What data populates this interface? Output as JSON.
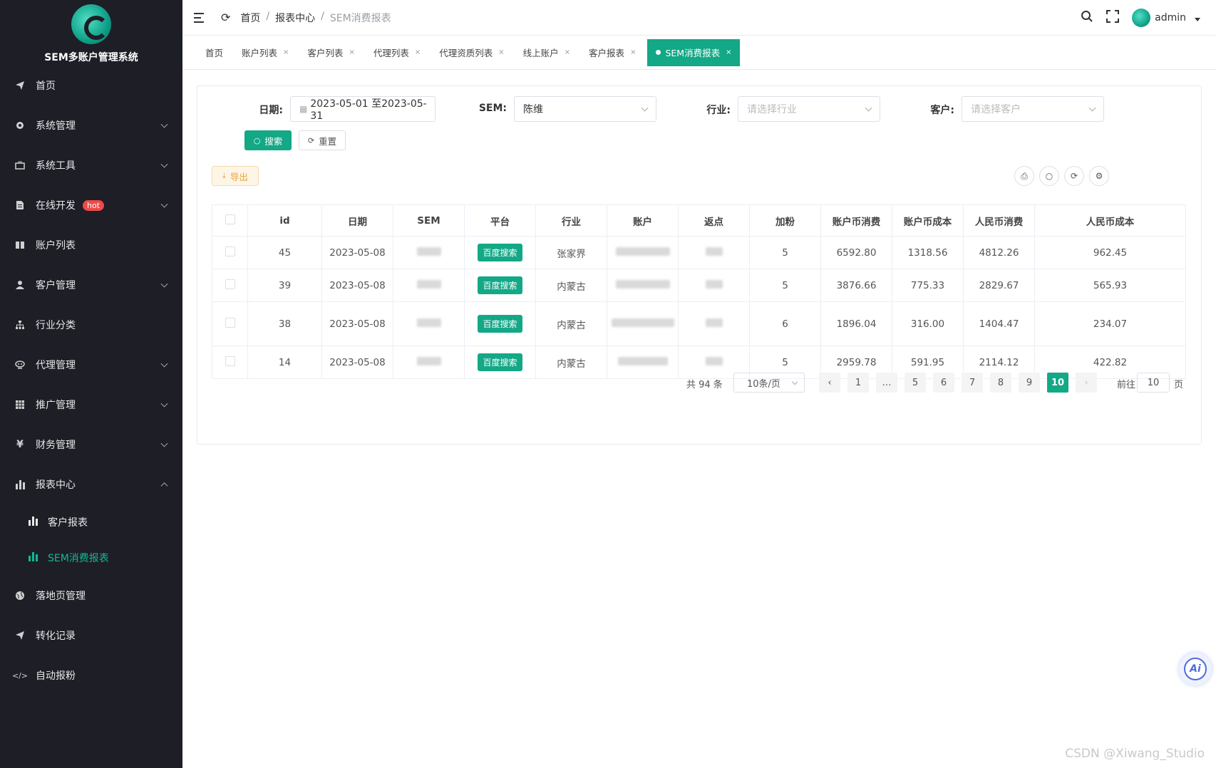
{
  "sidebar": {
    "title": "SEM多账户管理系统",
    "items": [
      {
        "label": "首页",
        "icon": "paper-plane-icon"
      },
      {
        "label": "系统管理",
        "icon": "gear-icon"
      },
      {
        "label": "系统工具",
        "icon": "toolbox-icon"
      },
      {
        "label": "在线开发",
        "icon": "document-icon",
        "badge": "hot"
      },
      {
        "label": "账户列表",
        "icon": "book-icon"
      },
      {
        "label": "客户管理",
        "icon": "user-icon"
      },
      {
        "label": "行业分类",
        "icon": "sitemap-icon"
      },
      {
        "label": "代理管理",
        "icon": "agent-icon"
      },
      {
        "label": "推广管理",
        "icon": "grid-icon"
      },
      {
        "label": "财务管理",
        "icon": "yen-icon"
      },
      {
        "label": "报表中心",
        "icon": "bar-chart-icon"
      }
    ],
    "sub_items": [
      {
        "label": "客户报表"
      },
      {
        "label": "SEM消费报表"
      }
    ],
    "items_after": [
      {
        "label": "落地页管理",
        "icon": "globe-icon"
      },
      {
        "label": "转化记录",
        "icon": "paper-plane-icon"
      },
      {
        "label": "自动报粉",
        "icon": "code-icon"
      }
    ]
  },
  "topbar": {
    "breadcrumb": [
      "首页",
      "报表中心",
      "SEM消费报表"
    ],
    "user": "admin"
  },
  "tabs": [
    {
      "label": "首页"
    },
    {
      "label": "账户列表"
    },
    {
      "label": "客户列表"
    },
    {
      "label": "代理列表"
    },
    {
      "label": "代理资质列表"
    },
    {
      "label": "线上账户"
    },
    {
      "label": "客户报表"
    },
    {
      "label": "SEM消费报表"
    }
  ],
  "filters": {
    "date_label": "日期:",
    "date_value": "2023-05-01 至2023-05-31",
    "sem_label": "SEM:",
    "sem_value": "陈维",
    "industry_label": "行业:",
    "industry_placeholder": "请选择行业",
    "customer_label": "客户:",
    "customer_placeholder": "请选择客户",
    "search_label": "搜索",
    "reset_label": "重置",
    "export_label": "导出"
  },
  "table": {
    "columns": [
      "id",
      "日期",
      "SEM",
      "平台",
      "行业",
      "账户",
      "返点",
      "加粉",
      "账户币消费",
      "账户币成本",
      "人民币消费",
      "人民币成本"
    ],
    "rows": [
      {
        "id": "45",
        "date": "2023-05-08",
        "platform": "百度搜索",
        "industry": "张家界",
        "fans": "5",
        "acct_spend": "6592.80",
        "acct_cost": "1318.56",
        "rmb_spend": "4812.26",
        "rmb_cost": "962.45"
      },
      {
        "id": "39",
        "date": "2023-05-08",
        "platform": "百度搜索",
        "industry": "内蒙古",
        "fans": "5",
        "acct_spend": "3876.66",
        "acct_cost": "775.33",
        "rmb_spend": "2829.67",
        "rmb_cost": "565.93"
      },
      {
        "id": "38",
        "date": "2023-05-08",
        "platform": "百度搜索",
        "industry": "内蒙古",
        "fans": "6",
        "acct_spend": "1896.04",
        "acct_cost": "316.00",
        "rmb_spend": "1404.47",
        "rmb_cost": "234.07"
      },
      {
        "id": "14",
        "date": "2023-05-08",
        "platform": "百度搜索",
        "industry": "内蒙古",
        "fans": "5",
        "acct_spend": "2959.78",
        "acct_cost": "591.95",
        "rmb_spend": "2114.12",
        "rmb_cost": "422.82"
      }
    ]
  },
  "pagination": {
    "total": "共 94 条",
    "page_size": "10条/页",
    "pages": [
      "1",
      "…",
      "5",
      "6",
      "7",
      "8",
      "9",
      "10"
    ],
    "current": "10",
    "goto_label": "前往",
    "goto_value": "10",
    "goto_suffix": "页"
  },
  "ai_label": "Ai",
  "watermark": "CSDN @Xiwang_Studio",
  "colors": {
    "accent": "#13a886",
    "sidebar_bg": "#1d1e26",
    "hot": "#ee4a4a"
  }
}
